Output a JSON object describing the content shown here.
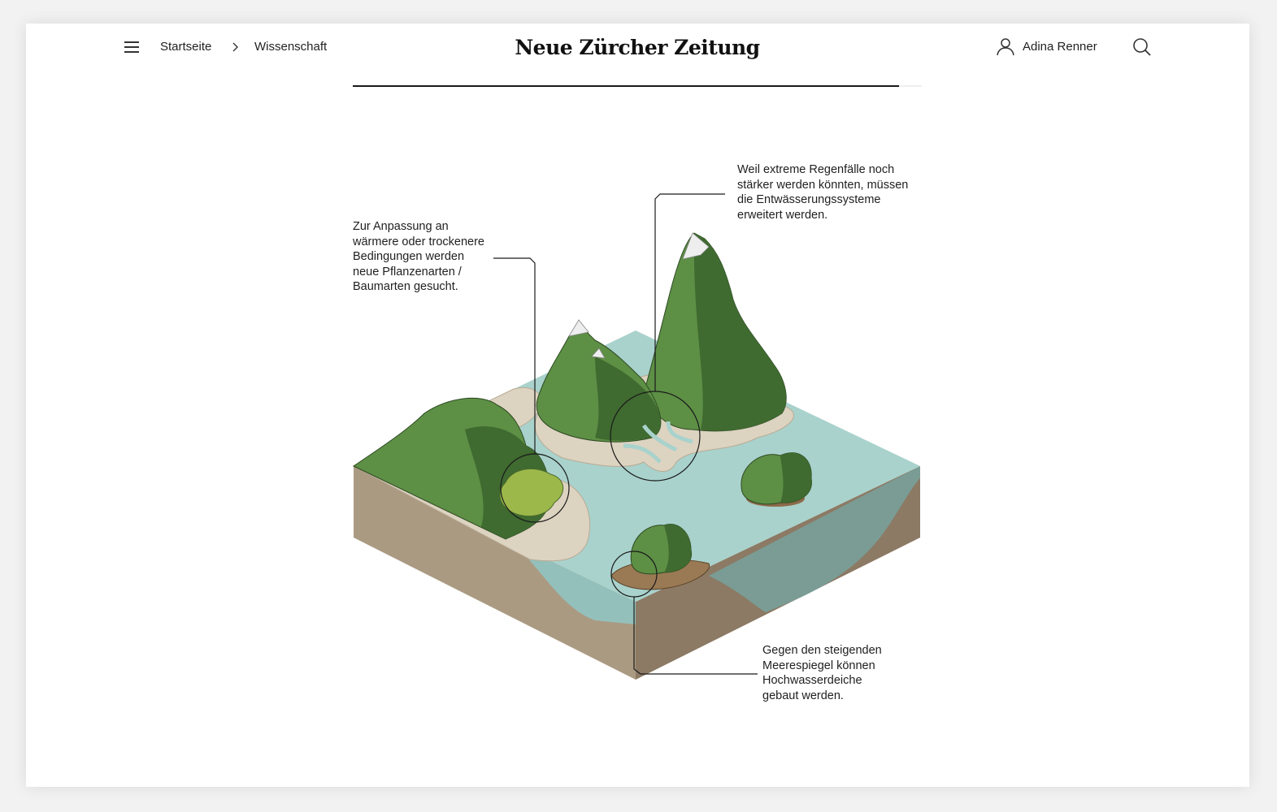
{
  "header": {
    "breadcrumb": [
      {
        "label": "Startseite"
      },
      {
        "label": "Wissenschaft"
      }
    ],
    "logo_text": "Neue Zürcher Zeitung",
    "user_name": "Adina Renner"
  },
  "reading_progress": 0.96,
  "illustration": {
    "annotations": [
      {
        "id": "plants",
        "text": "Zur Anpassung an\nwärmere oder trockenere\nBedingungen werden\nneue Pflanzenarten /\nBaumarten gesucht."
      },
      {
        "id": "drainage",
        "text": "Weil extreme Regenfälle noch\nstärker werden könnten, müssen\ndie Entwässerungssysteme\nerweitert werden."
      },
      {
        "id": "dikes",
        "text": "Gegen den steigenden\nMeerespiegel können\nHochwasserdeiche\ngebaut werden."
      }
    ]
  },
  "colors": {
    "water": "#a9d2cc",
    "forest": "#5d8f45",
    "forest_dark": "#3f6a30",
    "sand": "#ddd3c1",
    "soil": "#ab9a82",
    "soil_dark": "#8c7a65"
  }
}
